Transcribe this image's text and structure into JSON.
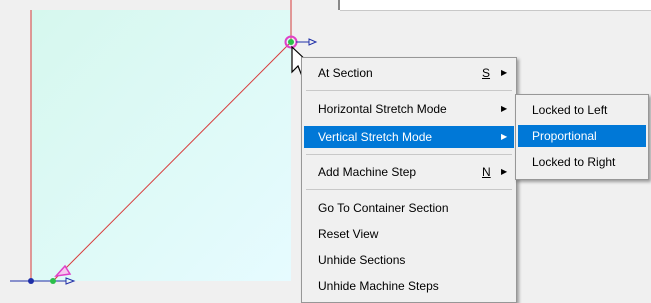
{
  "context_menu": {
    "items": [
      {
        "label": "At Section",
        "shortcut": "S",
        "submenu": true
      },
      {
        "label": "Horizontal Stretch Mode",
        "submenu": true
      },
      {
        "label": "Vertical Stretch Mode",
        "submenu": true,
        "highlighted": true
      },
      {
        "label": "Add Machine Step",
        "shortcut": "N",
        "submenu": true
      },
      {
        "label": "Go To Container Section"
      },
      {
        "label": "Reset View"
      },
      {
        "label": "Unhide Sections"
      },
      {
        "label": "Unhide Machine Steps"
      }
    ]
  },
  "submenu": {
    "items": [
      {
        "label": "Locked to Left"
      },
      {
        "label": "Proportional",
        "highlighted": true
      },
      {
        "label": "Locked to Right"
      }
    ]
  },
  "colors": {
    "canvas_fill": "#e6fbf5",
    "line": "#d83a3a",
    "highlight": "#0078d7",
    "handle_magenta": "#e040c8",
    "handle_green": "#2bbf4a",
    "axis_blue": "#1f2fa8"
  },
  "icons": [
    "arrow-cursor-icon",
    "submenu-arrow-icon",
    "handle-icon"
  ]
}
